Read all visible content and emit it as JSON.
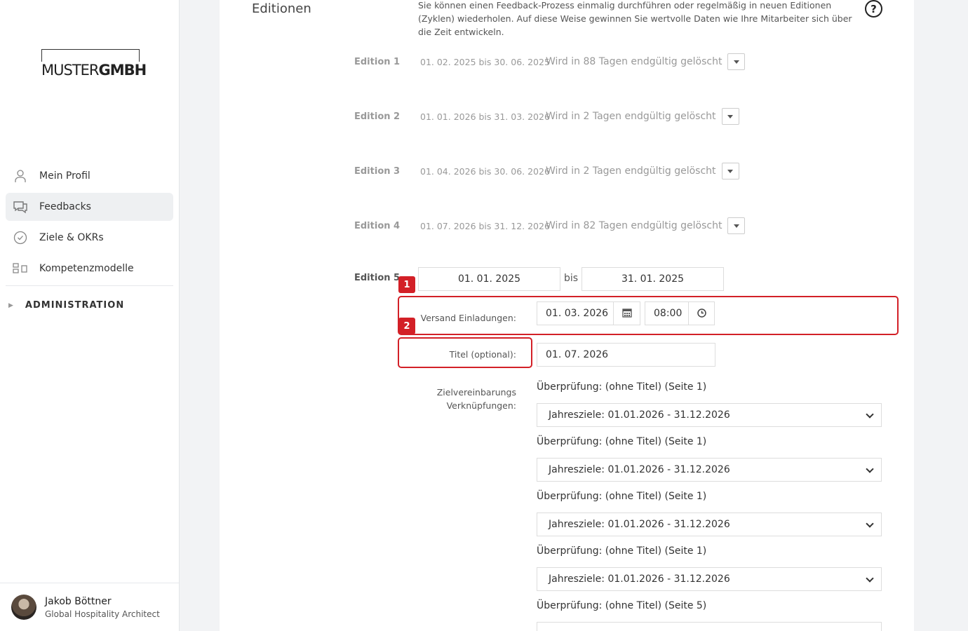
{
  "sidebar": {
    "logo": {
      "light": "MUSTER",
      "bold": "GMBH"
    },
    "nav": [
      {
        "label": "Mein Profil",
        "icon": "user-icon"
      },
      {
        "label": "Feedbacks",
        "icon": "chat-icon",
        "active": true
      },
      {
        "label": "Ziele & OKRs",
        "icon": "check-circle-icon"
      },
      {
        "label": "Kompetenzmodelle",
        "icon": "model-icon"
      }
    ],
    "admin_label": "ADMINISTRATION",
    "user": {
      "name": "Jakob Böttner",
      "role": "Global Hospitality Architect"
    }
  },
  "main": {
    "section_title": "Editionen",
    "intro": "Sie können einen Feedback-Prozess einmalig durchführen oder regelmäßig in neuen Editionen (Zyklen) wiederholen. Auf diese Weise gewinnen Sie wertvolle Daten wie Ihre Mitarbeiter sich über die Zeit entwickeln.",
    "editions": [
      {
        "label": "Edition 1",
        "dates": "01. 02. 2025 bis 30. 06. 2025",
        "status": "Wird in 88 Tagen endgültig gelöscht"
      },
      {
        "label": "Edition 2",
        "dates": "01. 01. 2026 bis 31. 03. 2026",
        "status": "Wird in 2 Tagen endgültig gelöscht"
      },
      {
        "label": "Edition 3",
        "dates": "01. 04. 2026 bis 30. 06. 2026",
        "status": "Wird in 2 Tagen endgültig gelöscht"
      },
      {
        "label": "Edition 4",
        "dates": "01. 07. 2026 bis 31. 12. 2026",
        "status": "Wird in 82 Tagen endgültig gelöscht"
      }
    ],
    "edition5": {
      "label": "Edition 5",
      "start": "01. 01. 2025",
      "bis": "bis",
      "end": "31. 01. 2025",
      "versand_label": "Versand Einladungen:",
      "versand_date": "01. 03. 2026",
      "versand_time": "08:00",
      "titel_label": "Titel (optional):",
      "titel_value": "01. 07. 2026",
      "ziel_label_1": "Zielvereinbarungs",
      "ziel_label_2": "Verknüpfungen:"
    },
    "links": [
      {
        "title": "Überprüfung: (ohne Titel) (Seite 1)",
        "value": "Jahresziele: 01.01.2026 - 31.12.2026"
      },
      {
        "title": "Überprüfung: (ohne Titel) (Seite 1)",
        "value": "Jahresziele: 01.01.2026 - 31.12.2026"
      },
      {
        "title": "Überprüfung: (ohne Titel) (Seite 1)",
        "value": "Jahresziele: 01.01.2026 - 31.12.2026"
      },
      {
        "title": "Überprüfung: (ohne Titel) (Seite 1)",
        "value": "Jahresziele: 01.01.2026 - 31.12.2026"
      },
      {
        "title": "Überprüfung: (ohne Titel) (Seite 5)",
        "value": ""
      }
    ],
    "badges": [
      "1",
      "2"
    ]
  }
}
